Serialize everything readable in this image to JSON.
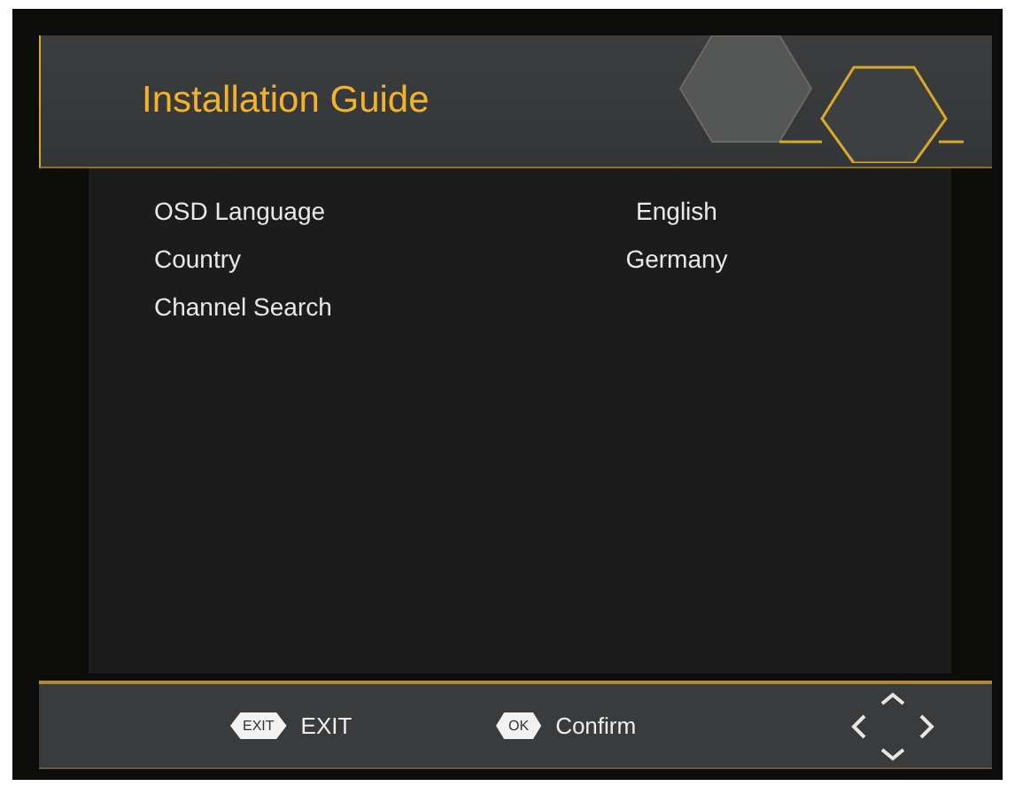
{
  "header": {
    "title": "Installation Guide"
  },
  "settings": [
    {
      "label": "OSD Language",
      "value": "English"
    },
    {
      "label": "Country",
      "value": "Germany"
    },
    {
      "label": "Channel Search"
    }
  ],
  "footer": {
    "hints": [
      {
        "key": "EXIT",
        "label": "EXIT"
      },
      {
        "key": "OK",
        "label": "Confirm"
      }
    ]
  }
}
